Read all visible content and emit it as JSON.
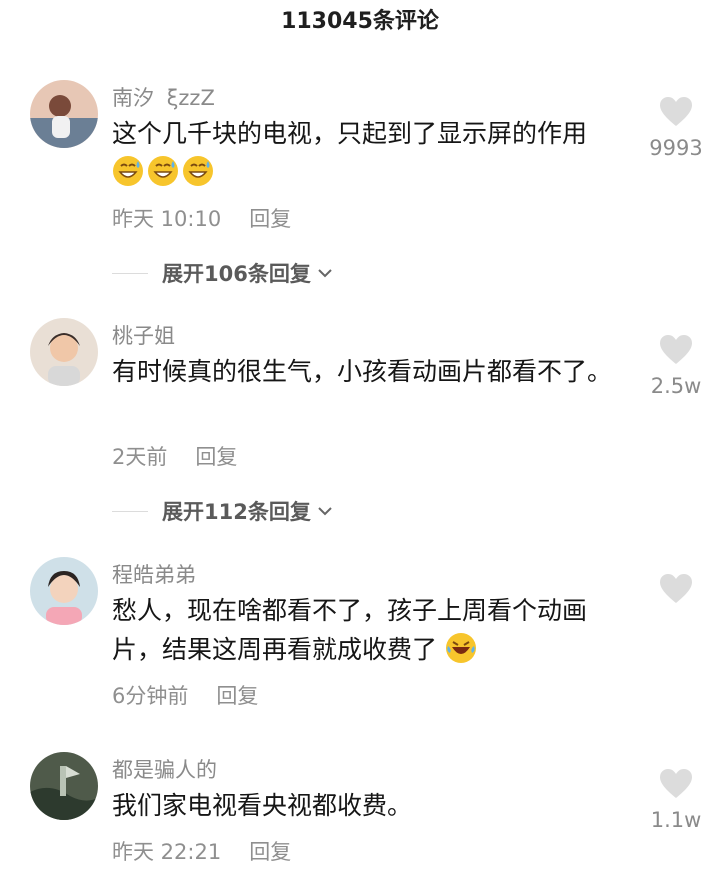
{
  "header": {
    "title": "113045条评论"
  },
  "comments": [
    {
      "username": "南汐",
      "username_suffix": "ξzzZ",
      "text": "这个几千块的电视，只起到了显示屏的作用",
      "emoji_count": 3,
      "time": "昨天 10:10",
      "reply_label": "回复",
      "likes": "9993",
      "expand_label": "展开106条回复"
    },
    {
      "username": "桃子姐",
      "text": "有时候真的很生气，小孩看动画片都看不了。",
      "time": "2天前",
      "reply_label": "回复",
      "likes": "2.5w",
      "expand_label": "展开112条回复"
    },
    {
      "username": "程皓弟弟",
      "text": "愁人，现在啥都看不了，孩子上周看个动画片，结果这周再看就成收费了",
      "emoji_count": 1,
      "time": "6分钟前",
      "reply_label": "回复",
      "likes": ""
    },
    {
      "username": "都是骗人的",
      "text": "我们家电视看央视都收费。",
      "time": "昨天 22:21",
      "reply_label": "回复",
      "likes": "1.1w"
    }
  ],
  "icons": {
    "like": "heart-icon",
    "expand": "chevron-down-icon",
    "emoji": "grinning-sweat-emoji-icon"
  },
  "colors": {
    "text": "#161616",
    "secondary": "#8a8a8a",
    "heart": "#dcdcdc"
  }
}
